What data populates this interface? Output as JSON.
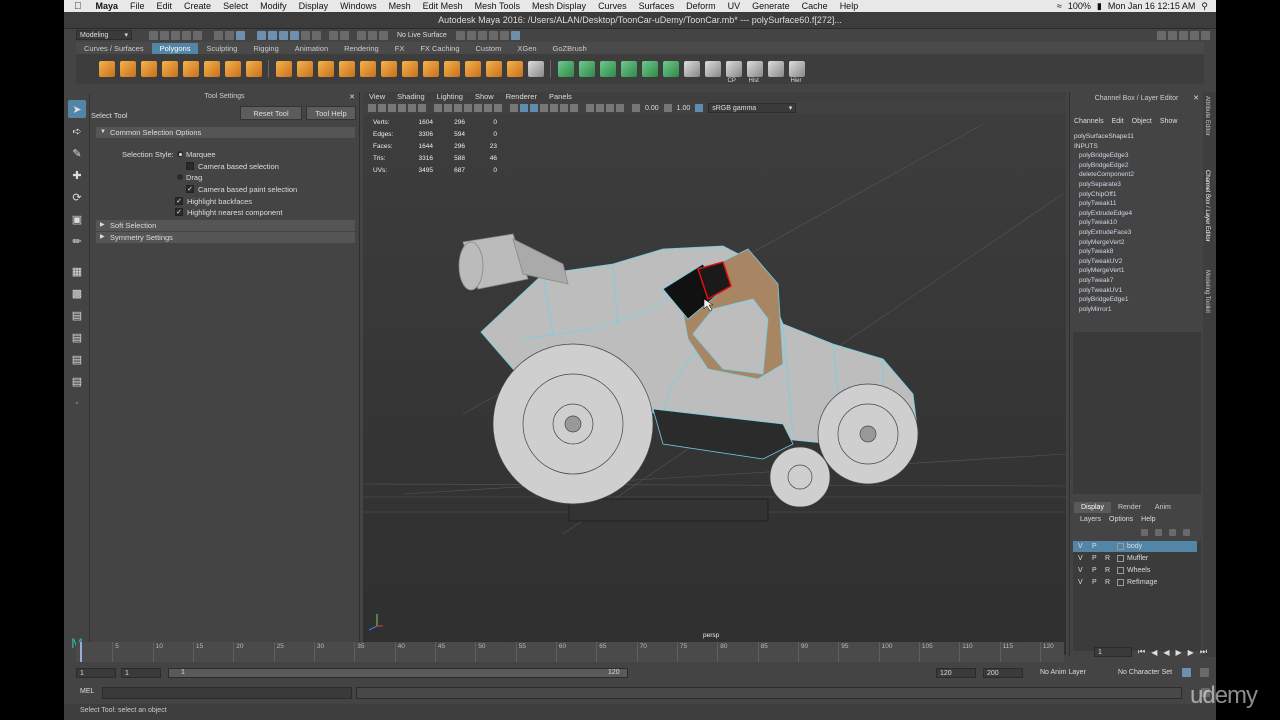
{
  "mac_menubar": {
    "app": "Maya",
    "items": [
      "File",
      "Edit",
      "Create",
      "Select",
      "Modify",
      "Display",
      "Windows",
      "Mesh",
      "Edit Mesh",
      "Mesh Tools",
      "Mesh Display",
      "Curves",
      "Surfaces",
      "Deform",
      "UV",
      "Generate",
      "Cache",
      "Help"
    ],
    "battery": "100%",
    "clock": "Mon Jan 16  12:15 AM"
  },
  "window": {
    "title": "Autodesk Maya 2016: /Users/ALAN/Desktop/ToonCar-uDemy/ToonCar.mb*   ---   polySurface60.f[272]..."
  },
  "toolbar": {
    "mode": "Modeling",
    "live_surface": "No Live Surface"
  },
  "shelf": {
    "tabs": [
      "Curves / Surfaces",
      "Polygons",
      "Sculpting",
      "Rigging",
      "Animation",
      "Rendering",
      "FX",
      "FX Caching",
      "Custom",
      "XGen",
      "GoZBrush"
    ],
    "active_tab": "Polygons",
    "icon_labels": [
      "CP",
      "Hist",
      "Hier"
    ]
  },
  "tool_settings": {
    "header": "Tool Settings",
    "tool_name": "Select Tool",
    "reset_button": "Reset Tool",
    "help_button": "Tool Help",
    "section_common": "Common Selection Options",
    "selection_style_label": "Selection Style:",
    "marquee": "Marquee",
    "camera_based_selection": "Camera based selection",
    "drag": "Drag",
    "camera_based_paint": "Camera based paint selection",
    "highlight_backfaces": "Highlight backfaces",
    "highlight_nearest": "Highlight nearest component",
    "section_soft": "Soft Selection",
    "section_symmetry": "Symmetry Settings",
    "checks": {
      "camera_based_selection": false,
      "camera_based_paint": true,
      "highlight_backfaces": true,
      "highlight_nearest": true
    }
  },
  "viewport": {
    "menus": [
      "View",
      "Shading",
      "Lighting",
      "Show",
      "Renderer",
      "Panels"
    ],
    "exposure": "0.00",
    "gamma": "1.00",
    "color_space": "sRGB gamma",
    "camera": "persp",
    "hud": [
      {
        "label": "Verts:",
        "a": "1604",
        "b": "296",
        "c": "0"
      },
      {
        "label": "Edges:",
        "a": "3306",
        "b": "594",
        "c": "0"
      },
      {
        "label": "Faces:",
        "a": "1644",
        "b": "296",
        "c": "23"
      },
      {
        "label": "Tris:",
        "a": "3316",
        "b": "588",
        "c": "46"
      },
      {
        "label": "UVs:",
        "a": "3495",
        "b": "687",
        "c": "0"
      }
    ]
  },
  "channel_box": {
    "header": "Channel Box / Layer Editor",
    "menus": [
      "Channels",
      "Edit",
      "Object",
      "Show"
    ],
    "object": "polySurfaceShape11",
    "inputs_label": "INPUTS",
    "inputs": [
      "polyBridgeEdge3",
      "polyBridgeEdge2",
      "deleteComponent2",
      "polySeparate3",
      "polyChipOff1",
      "polyTweak11",
      "polyExtrudeEdge4",
      "polyTweak10",
      "polyExtrudeFace3",
      "polyMergeVert2",
      "polyTweak8",
      "polyTweakUV2",
      "polyMergeVert1",
      "polyTweak7",
      "polyTweakUV1",
      "polyBridgeEdge1",
      "polyMirror1"
    ]
  },
  "layer_editor": {
    "tabs": [
      "Display",
      "Render",
      "Anim"
    ],
    "active_tab": "Display",
    "menus": [
      "Layers",
      "Options",
      "Help"
    ],
    "layers": [
      {
        "v": "V",
        "p": "P",
        "r": "",
        "name": "body",
        "selected": true
      },
      {
        "v": "V",
        "p": "P",
        "r": "R",
        "name": "Muffler",
        "selected": false
      },
      {
        "v": "V",
        "p": "P",
        "r": "R",
        "name": "Wheels",
        "selected": false
      },
      {
        "v": "V",
        "p": "P",
        "r": "R",
        "name": "RefImage",
        "selected": false
      }
    ]
  },
  "side_tabs": [
    "Attribute Editor",
    "Channel Box / Layer Editor",
    "Modeling Toolkit"
  ],
  "timeline": {
    "ticks": [
      "5",
      "10",
      "15",
      "20",
      "25",
      "30",
      "35",
      "40",
      "45",
      "50",
      "55",
      "60",
      "65",
      "70",
      "75",
      "80",
      "85",
      "90",
      "95",
      "100",
      "105",
      "110",
      "115",
      "120"
    ],
    "current_frame": "1"
  },
  "range": {
    "start": "1",
    "start_inner": "1",
    "slider_start": "1",
    "slider_end": "120",
    "end_inner": "120",
    "end": "200",
    "anim_layer": "No Anim Layer",
    "char_set": "No Character Set"
  },
  "command_line": {
    "label": "MEL"
  },
  "help_line": "Select Tool: select an object",
  "watermark": "udemy"
}
